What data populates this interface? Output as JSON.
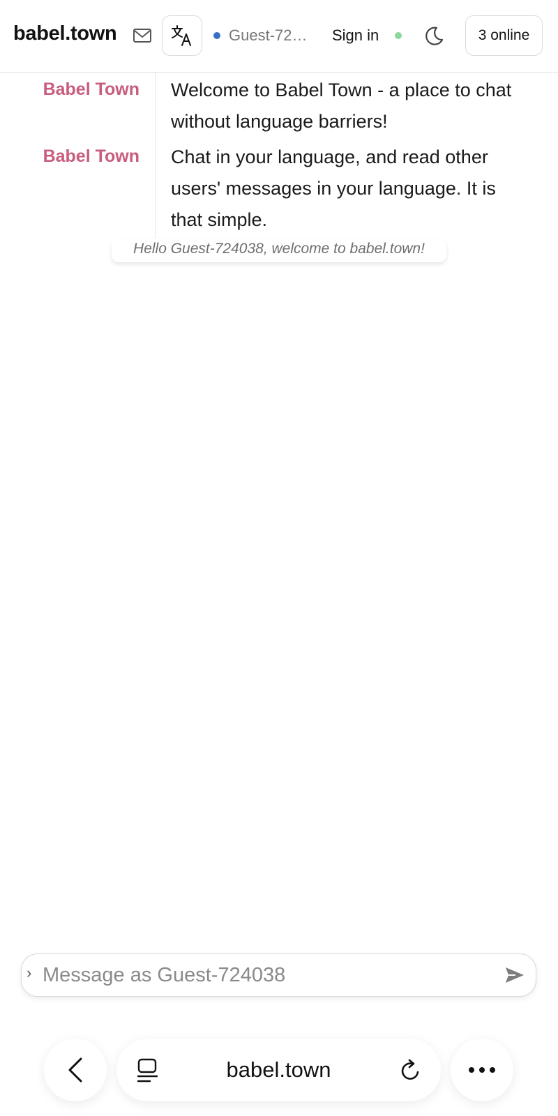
{
  "header": {
    "brand": "babel.town",
    "guest_name": "Guest-724038",
    "sign_in": "Sign in",
    "online_count": "3 online",
    "icons": {
      "mail": "mail-icon",
      "translate": "translate-icon",
      "theme": "moon-icon"
    },
    "colors": {
      "guest_dot": "#3a6fc4",
      "online_dot": "#8ad89a"
    }
  },
  "messages": [
    {
      "author": "Babel Town",
      "text": "Welcome to Babel Town - a place to chat without language barriers!"
    },
    {
      "author": "Babel Town",
      "text": "Chat in your language, and read other users' messages in your language. It is that simple."
    }
  ],
  "system_note": "Hello Guest-724038, welcome to babel.town!",
  "composer": {
    "placeholder": "Message as Guest-724038",
    "value": "",
    "icons": {
      "expand": "chevron-right-icon",
      "send": "send-icon"
    }
  },
  "browser": {
    "url": "babel.town",
    "icons": {
      "back": "chevron-left-icon",
      "tabs": "tabs-icon",
      "reload": "reload-icon",
      "more": "more-icon"
    }
  },
  "colors": {
    "author": "#c85d7d"
  }
}
